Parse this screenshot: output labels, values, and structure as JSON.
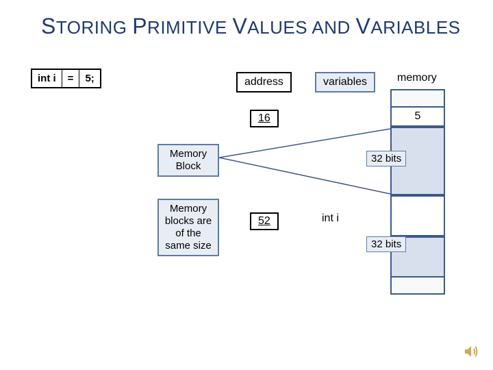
{
  "title_parts": {
    "s": "S",
    "toring": "TORING ",
    "p": "P",
    "rimitive": "RIMITIVE ",
    "v": "V",
    "alues": "ALUES ",
    "and": "AND ",
    "v2": "V",
    "ariables": "ARIABLES"
  },
  "code": {
    "decl": "int i",
    "eq": "=",
    "val": "5;"
  },
  "headers": {
    "address": "address",
    "variables": "variables",
    "memory": "memory"
  },
  "addresses": {
    "a1": "16",
    "a2": "52"
  },
  "labels": {
    "memblock": "Memory Block",
    "memsize": "Memory blocks are of the same size",
    "var": "int i",
    "bits1": "32 bits",
    "bits2": "32 bits"
  },
  "memory": {
    "cell5": "5"
  },
  "chart_data": {
    "type": "table",
    "title": "Storing Primitive Values and Variables",
    "declaration": "int i = 5;",
    "rows": [
      {
        "address": 16,
        "variable": null,
        "memory_value": 5,
        "block_bits": 32
      },
      {
        "address": 52,
        "variable": "int i",
        "memory_value": null,
        "block_bits": 32
      }
    ],
    "notes": [
      "Memory Block",
      "Memory blocks are of the same size"
    ]
  }
}
